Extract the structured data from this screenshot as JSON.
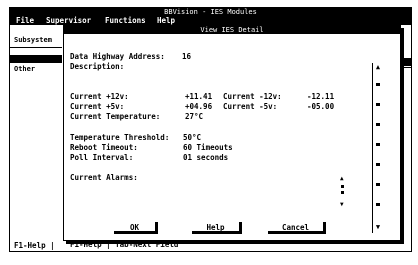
{
  "app": {
    "title": "BBVision - IES Modules"
  },
  "menu": {
    "file": "File",
    "supervisor": "Supervisor",
    "functions": "Functions",
    "help": "Help"
  },
  "sidebar": {
    "subsystem": "Subsystem",
    "other": "Other"
  },
  "dialog": {
    "title": "View IES Detail",
    "address_label": "Data Highway Address:",
    "address_value": "16",
    "description_label": "Description:",
    "description_value": "",
    "plus12_label": "Current +12v:",
    "plus12_value": "+11.41",
    "minus12_label": "Current -12v:",
    "minus12_value": "-12.11",
    "plus5_label": "Current +5v:",
    "plus5_value": "+04.96",
    "minus5_label": "Current -5v:",
    "minus5_value": "-05.00",
    "temp_label": "Current Temperature:",
    "temp_value": "27°C",
    "threshold_label": "Temperature Threshold:",
    "threshold_value": "50°C",
    "reboot_label": "Reboot Timeout:",
    "reboot_value": "60 Timeouts",
    "poll_label": "Poll Interval:",
    "poll_value": "01 seconds",
    "alarms_label": "Current Alarms:",
    "alarms_value": ""
  },
  "buttons": {
    "ok": "OK",
    "help": "Help",
    "cancel": "Cancel"
  },
  "hints": {
    "dialog_hint": "F1-Help | Tab-Next Field",
    "status_hint": "F1-Help |"
  }
}
